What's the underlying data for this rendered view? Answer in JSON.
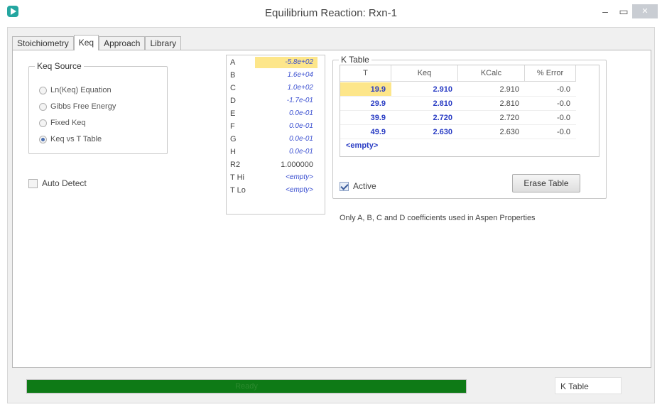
{
  "window": {
    "title": "Equilibrium Reaction: Rxn-1",
    "min_glyph": "–",
    "max_glyph": "▭",
    "close_glyph": "✕"
  },
  "tabs": [
    {
      "label": "Stoichiometry",
      "active": false
    },
    {
      "label": "Keq",
      "active": true
    },
    {
      "label": "Approach",
      "active": false
    },
    {
      "label": "Library",
      "active": false
    }
  ],
  "keq_source": {
    "legend": "Keq Source",
    "options": [
      {
        "label": "Ln(Keq) Equation",
        "checked": false
      },
      {
        "label": "Gibbs Free Energy",
        "checked": false
      },
      {
        "label": "Fixed Keq",
        "checked": false
      },
      {
        "label": "Keq vs T Table",
        "checked": true
      }
    ]
  },
  "auto_detect": {
    "label": "Auto Detect",
    "checked": false
  },
  "coefficients": [
    {
      "name": "A",
      "value": "-5.8e+02"
    },
    {
      "name": "B",
      "value": "1.6e+04"
    },
    {
      "name": "C",
      "value": "1.0e+02"
    },
    {
      "name": "D",
      "value": "-1.7e-01"
    },
    {
      "name": "E",
      "value": "0.0e-01"
    },
    {
      "name": "F",
      "value": "0.0e-01"
    },
    {
      "name": "G",
      "value": "0.0e-01"
    },
    {
      "name": "H",
      "value": "0.0e-01"
    },
    {
      "name": "R2",
      "value": "1.000000"
    },
    {
      "name": "T Hi",
      "value": "<empty>"
    },
    {
      "name": "T Lo",
      "value": "<empty>"
    }
  ],
  "k_table": {
    "legend": "K Table",
    "columns": [
      "T",
      "Keq",
      "KCalc",
      "% Error"
    ],
    "rows": [
      {
        "t": "19.9",
        "keq": "2.910",
        "kcalc": "2.910",
        "error": "-0.0"
      },
      {
        "t": "29.9",
        "keq": "2.810",
        "kcalc": "2.810",
        "error": "-0.0"
      },
      {
        "t": "39.9",
        "keq": "2.720",
        "kcalc": "2.720",
        "error": "-0.0"
      },
      {
        "t": "49.9",
        "keq": "2.630",
        "kcalc": "2.630",
        "error": "-0.0"
      }
    ],
    "empty_row": "<empty>",
    "active_label": "Active",
    "active_checked": true,
    "erase_button": "Erase Table"
  },
  "note": "Only A, B, C and D coefficients used in Aspen Properties",
  "status": {
    "progress_text": "Ready",
    "progress_fraction": 1.0,
    "status_box": "K Table"
  }
}
